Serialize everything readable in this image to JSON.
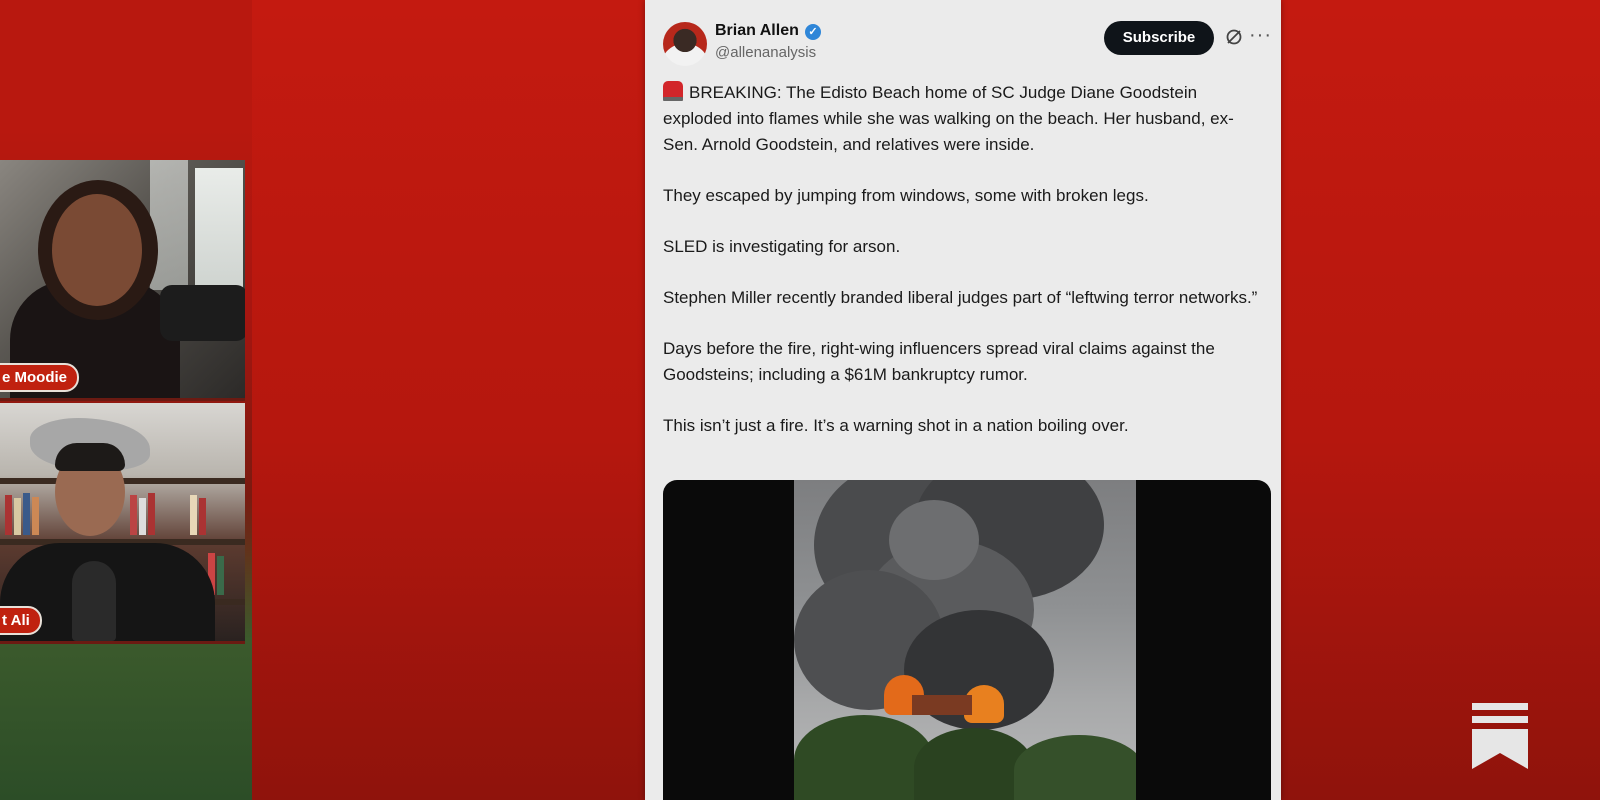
{
  "participants": [
    {
      "name_tag": "e Moodie"
    },
    {
      "name_tag": "t Ali"
    }
  ],
  "tweet": {
    "author_name": "Brian Allen",
    "handle": "@allenanalysis",
    "subscribe_label": "Subscribe",
    "paragraphs": [
      "BREAKING: The Edisto Beach home of SC Judge Diane Goodstein exploded into flames while she was walking on the beach. Her husband, ex-Sen. Arnold Goodstein, and relatives were inside.",
      "They escaped by jumping from windows, some with broken legs.",
      "SLED is investigating for arson.",
      "Stephen Miller recently branded liberal judges part of “leftwing terror networks.”",
      "Days before the fire, right-wing influencers spread viral claims against the Goodsteins; including a $61M bankruptcy rumor.",
      "This isn’t just a fire. It’s a warning shot in a nation boiling over."
    ]
  },
  "icons": {
    "verified": "verified-badge-icon",
    "grok": "grok-icon",
    "more": "more-options-icon",
    "siren": "siren-emoji-icon",
    "brand": "substack-logo-icon"
  },
  "colors": {
    "background_red": "#c41a10",
    "verified_blue": "#2f86d8",
    "subscribe_bg": "#0f1419",
    "name_tag_red": "#c0210f"
  }
}
